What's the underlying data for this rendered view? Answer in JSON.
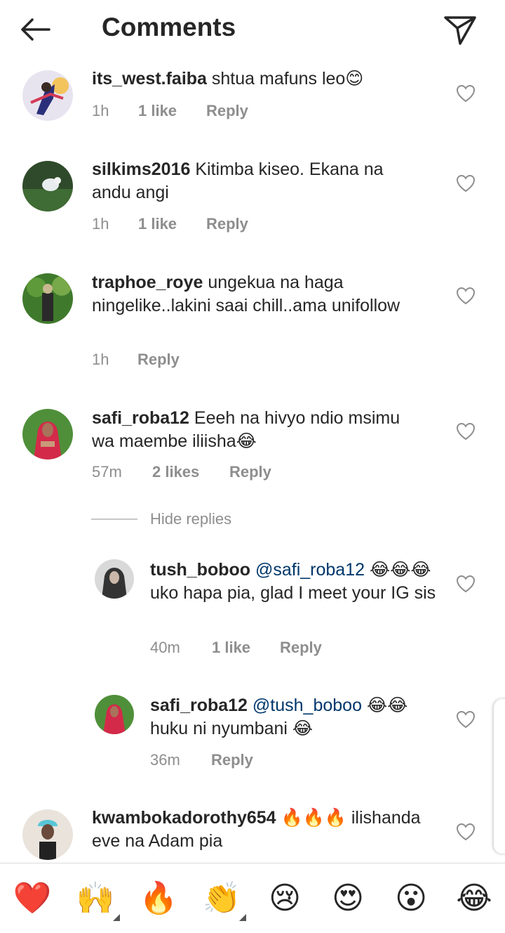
{
  "header": {
    "title": "Comments"
  },
  "comments": [
    {
      "username": "its_west.faiba",
      "text": "shtua mafuns leo😊",
      "time": "1h",
      "likes": "1 like",
      "reply": "Reply"
    },
    {
      "username": "silkims2016",
      "text": "Kitimba kiseo. Ekana na andu angi",
      "time": "1h",
      "likes": "1 like",
      "reply": "Reply"
    },
    {
      "username": "traphoe_roye",
      "text": "ungekua na haga ningelike..lakini saai chill..ama unifollow",
      "time": "1h",
      "likes": "",
      "reply": "Reply"
    },
    {
      "username": "safi_roba12",
      "text": "Eeeh na hivyo ndio msimu wa maembe iliisha😂",
      "time": "57m",
      "likes": "2 likes",
      "reply": "Reply"
    }
  ],
  "hide_replies": "Hide replies",
  "replies": [
    {
      "username": "tush_boboo",
      "mention": "@safi_roba12",
      "text": "😂😂😂 uko hapa pia, glad I meet your IG sis",
      "time": "40m",
      "likes": "1 like",
      "reply": "Reply"
    },
    {
      "username": "safi_roba12",
      "mention": "@tush_boboo",
      "text": "😂😂 huku ni nyumbani 😂",
      "time": "36m",
      "likes": "",
      "reply": "Reply"
    }
  ],
  "last_comment": {
    "username": "kwambokadorothy654",
    "text": "🔥🔥🔥 ilishanda eve na Adam pia"
  },
  "emoji_bar": [
    "❤️",
    "🙌",
    "🔥",
    "👏",
    "😢",
    "😍",
    "😮",
    "😂"
  ],
  "colors": {
    "text": "#262626",
    "meta": "#8e8e8e",
    "mention": "#00376b",
    "heart_red": "#ed1c24"
  }
}
